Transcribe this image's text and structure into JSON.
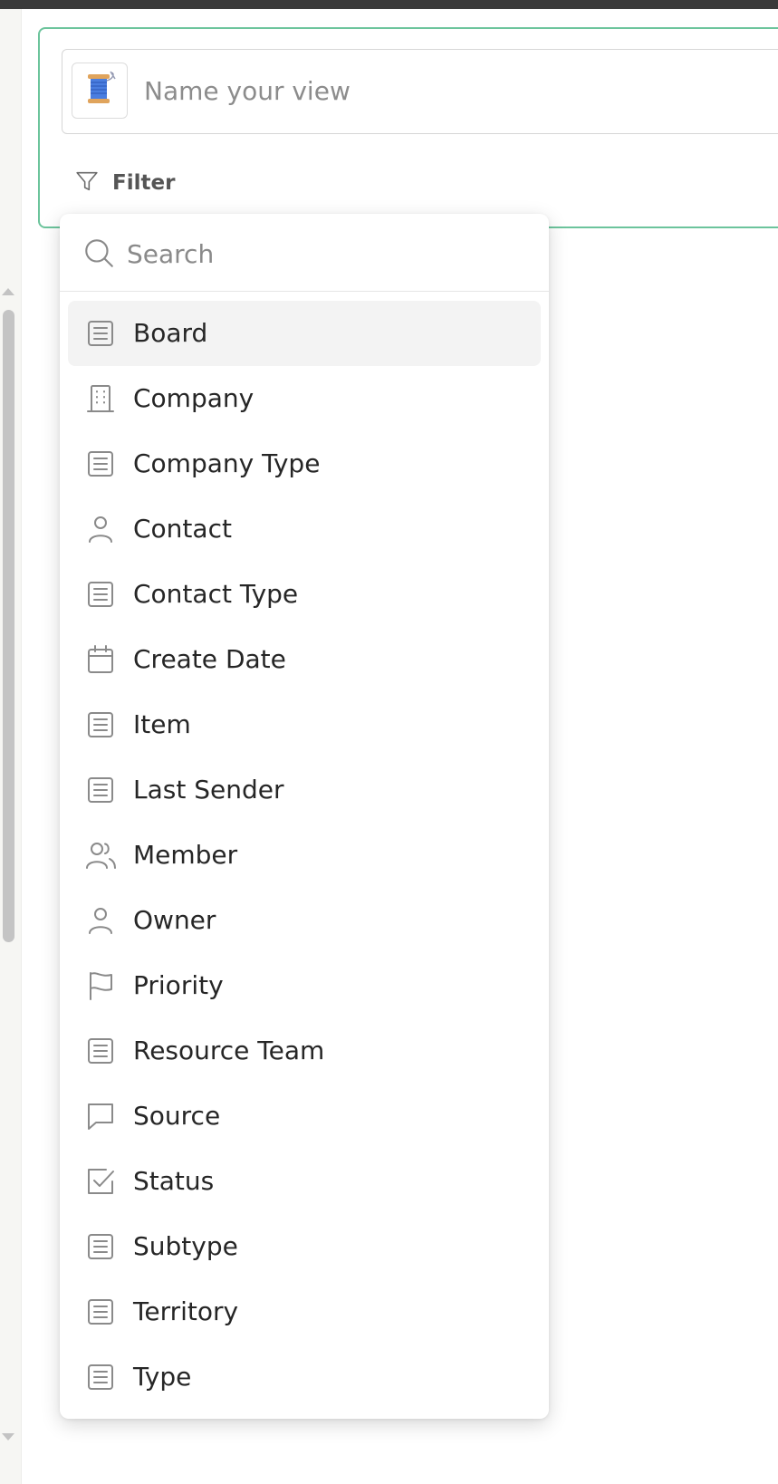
{
  "view": {
    "name_placeholder": "Name your view",
    "emoji_icon": "thread-spool-icon",
    "filter_label": "Filter"
  },
  "dropdown": {
    "search_placeholder": "Search",
    "items": [
      {
        "label": "Board",
        "icon": "text-field-icon",
        "active": true
      },
      {
        "label": "Company",
        "icon": "building-icon"
      },
      {
        "label": "Company Type",
        "icon": "text-field-icon"
      },
      {
        "label": "Contact",
        "icon": "person-icon"
      },
      {
        "label": "Contact Type",
        "icon": "text-field-icon"
      },
      {
        "label": "Create Date",
        "icon": "calendar-icon"
      },
      {
        "label": "Item",
        "icon": "text-field-icon"
      },
      {
        "label": "Last Sender",
        "icon": "text-field-icon"
      },
      {
        "label": "Member",
        "icon": "people-icon"
      },
      {
        "label": "Owner",
        "icon": "person-icon"
      },
      {
        "label": "Priority",
        "icon": "flag-icon"
      },
      {
        "label": "Resource Team",
        "icon": "text-field-icon"
      },
      {
        "label": "Source",
        "icon": "chat-bubble-icon"
      },
      {
        "label": "Status",
        "icon": "checkbox-icon"
      },
      {
        "label": "Subtype",
        "icon": "text-field-icon"
      },
      {
        "label": "Territory",
        "icon": "text-field-icon"
      },
      {
        "label": "Type",
        "icon": "text-field-icon"
      }
    ]
  },
  "colors": {
    "card_border": "#6cc49c",
    "active_row": "#f3f3f3",
    "icon_gray": "#8a8a8a"
  }
}
